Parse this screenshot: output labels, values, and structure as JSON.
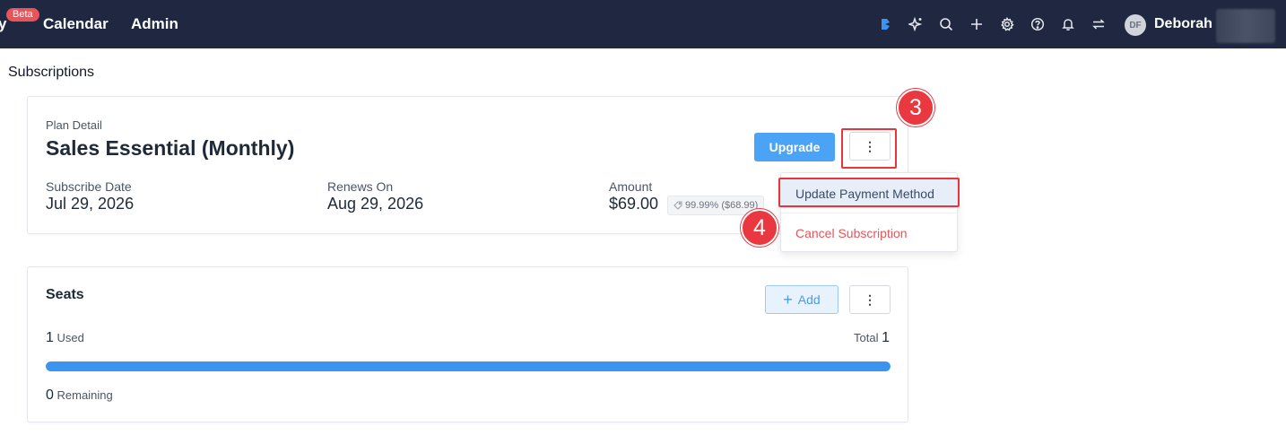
{
  "nav": {
    "truncated_item": "y",
    "beta_badge": "Beta",
    "items": [
      {
        "label": "Calendar"
      },
      {
        "label": "Admin"
      }
    ],
    "icons": [
      "brand-icon",
      "sparkle-icon",
      "search-icon",
      "plus-icon",
      "gear-icon",
      "help-icon",
      "bell-icon",
      "switch-icon"
    ],
    "user": {
      "initials": "DF",
      "name": "Deborah"
    }
  },
  "page": {
    "title": "Subscriptions"
  },
  "plan": {
    "label": "Plan Detail",
    "name": "Sales Essential (Monthly)",
    "upgrade_label": "Upgrade",
    "more_label": "⋮",
    "subscribe_label": "Subscribe Date",
    "subscribe_value": "Jul 29, 2026",
    "renews_label": "Renews On",
    "renews_value": "Aug 29, 2026",
    "amount_label": "Amount",
    "amount_value": "$69.00",
    "discount": "99.99% ($68.99)"
  },
  "menu": {
    "update_payment": "Update Payment Method",
    "cancel_subscription": "Cancel Subscription"
  },
  "annotations": {
    "step3": "3",
    "step4": "4"
  },
  "seats": {
    "title": "Seats",
    "add_icon": "+",
    "add_label": "Add",
    "more_label": "⋮",
    "used_count": "1",
    "used_label": "Used",
    "total_label": "Total",
    "total_count": "1",
    "remaining_count": "0",
    "remaining_label": "Remaining",
    "progress_fraction": 1.0
  },
  "colors": {
    "nav_bg": "#1f2840",
    "primary": "#4aa3f5",
    "danger": "#e8545a",
    "annotation": "#e9383f"
  }
}
